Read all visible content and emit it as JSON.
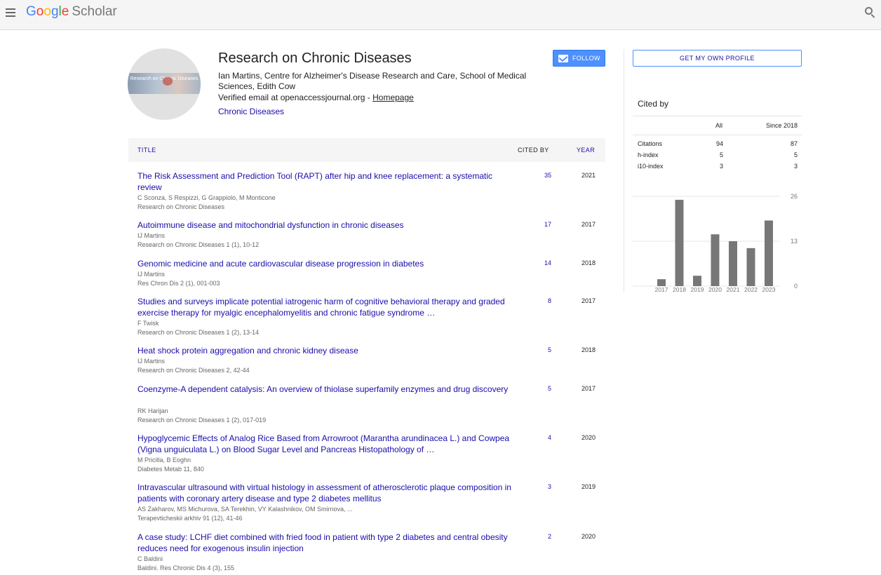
{
  "header": {
    "logo_google": "Google",
    "logo_scholar": "Scholar"
  },
  "profile": {
    "avatar_text": "Research on Chronic Diseases",
    "name": "Research on Chronic Diseases",
    "affiliation": "Ian Martins, Centre for Alzheimer's Disease Research and Care, School of Medical Sciences, Edith Cow",
    "email_text": "Verified email at openaccessjournal.org - ",
    "homepage_label": "Homepage",
    "interest": "Chronic Diseases",
    "follow_label": "FOLLOW"
  },
  "table": {
    "col_title": "TITLE",
    "col_cited": "CITED BY",
    "col_year": "YEAR",
    "rows": [
      {
        "title": "The Risk Assessment and Prediction Tool (RAPT) after hip and knee replacement: a systematic review",
        "authors": "C Sconza, S Respizzi, G Grappiolo, M Monticone",
        "venue": "Research on Chronic Diseases",
        "cites": "35",
        "year": "2021"
      },
      {
        "title": "Autoimmune disease and mitochondrial dysfunction in chronic diseases",
        "authors": "IJ Martins",
        "venue": "Research on Chronic Diseases 1 (1), 10-12",
        "cites": "17",
        "year": "2017"
      },
      {
        "title": "Genomic medicine and acute cardiovascular disease progression in diabetes",
        "authors": "IJ Martins",
        "venue": "Res Chron Dis 2 (1), 001-003",
        "cites": "14",
        "year": "2018"
      },
      {
        "title": "Studies and surveys implicate potential iatrogenic harm of cognitive behavioral therapy and graded exercise therapy for myalgic encephalomyelitis and chronic fatigue syndrome …",
        "authors": "F Twisk",
        "venue": "Research on Chronic Diseases 1 (2), 13-14",
        "cites": "8",
        "year": "2017"
      },
      {
        "title": "Heat shock protein aggregation and chronic kidney disease",
        "authors": "IJ Martins",
        "venue": "Research on Chronic Diseases 2, 42-44",
        "cites": "5",
        "year": "2018"
      },
      {
        "title": "Coenzyme-A dependent catalysis: An overview of thiolase superfamily enzymes and drug discovery",
        "authors": "RK Harijan",
        "venue": "Research on Chronic Diseases 1 (2), 017-019",
        "cites": "5",
        "year": "2017"
      },
      {
        "title": "Hypoglycemic Effects of Analog Rice Based from Arrowroot (Marantha arundinacea L.) and Cowpea (Vigna unguiculata L.) on Blood Sugar Level and Pancreas Histopathology of …",
        "authors": "M Pricilla, B Eoghn",
        "venue": "Diabetes Metab 11, 840",
        "cites": "4",
        "year": "2020"
      },
      {
        "title": "Intravascular ultrasound with virtual histology in assessment of atherosclerotic plaque composition in patients with coronary artery disease and type 2 diabetes mellitus",
        "authors": "AS Zakharov, MS Michurova, SA Terekhin, VY Kalashnikov, OM Smirnova, ...",
        "venue": "Terapevticheskii arkhiv 91 (12), 41-46",
        "cites": "3",
        "year": "2019"
      },
      {
        "title": "A case study: LCHF diet combined with fried food in patient with type 2 diabetes and central obesity reduces need for exogenous insulin injection",
        "authors": "C Baldini",
        "venue": "Baldini. Res Chronic Dis 4 (3), 155",
        "cites": "2",
        "year": "2020"
      }
    ]
  },
  "sidebar": {
    "get_profile_label": "GET MY OWN PROFILE",
    "cited_by_heading": "Cited by",
    "col_all": "All",
    "col_since": "Since 2018",
    "metrics": [
      {
        "label": "Citations",
        "all": "94",
        "since": "87"
      },
      {
        "label": "h-index",
        "all": "5",
        "since": "5"
      },
      {
        "label": "i10-index",
        "all": "3",
        "since": "3"
      }
    ]
  },
  "chart_data": {
    "type": "bar",
    "categories": [
      "2017",
      "2018",
      "2019",
      "2020",
      "2021",
      "2022",
      "2023"
    ],
    "values": [
      2,
      25,
      3,
      15,
      13,
      11,
      19
    ],
    "ylim": [
      0,
      26
    ],
    "yticks": [
      "26",
      "13",
      "0"
    ],
    "grid": true,
    "bar_color": "#777777"
  }
}
